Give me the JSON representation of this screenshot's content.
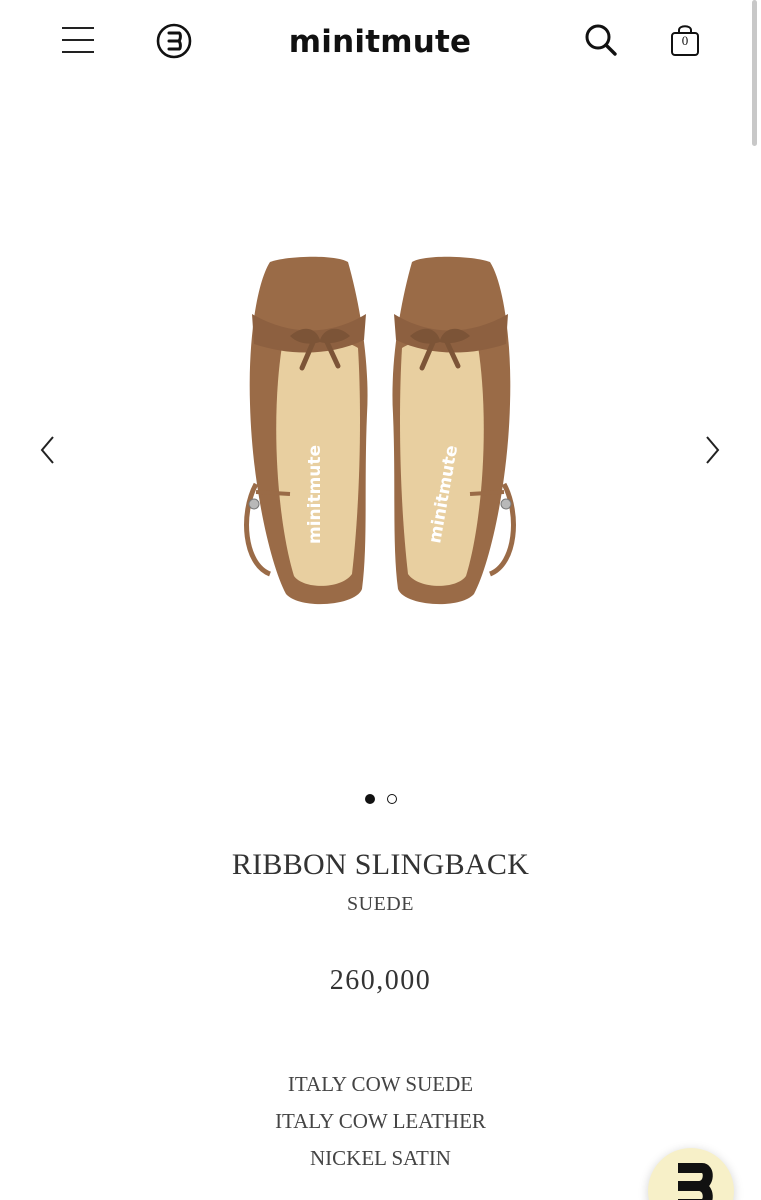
{
  "header": {
    "logo": "minitmute",
    "cart_count": "0",
    "icons": [
      "menu-icon",
      "e-circle-icon",
      "search-icon",
      "shopping-bag-icon"
    ]
  },
  "carousel": {
    "image_brand_text": "minitmute",
    "slide_count": 2,
    "active_slide": 1,
    "icons": [
      "chevron-left-icon",
      "chevron-right-icon"
    ]
  },
  "product": {
    "name": "RIBBON SLINGBACK",
    "variant": "SUEDE",
    "price": "260,000",
    "materials": [
      "ITALY COW SUEDE",
      "ITALY COW LEATHER",
      "NICKEL SATIN"
    ]
  },
  "colors": {
    "shoe_brown": "#9a6b47",
    "insole": "#e8cfa0",
    "fab_bg": "#f7f0c8"
  }
}
